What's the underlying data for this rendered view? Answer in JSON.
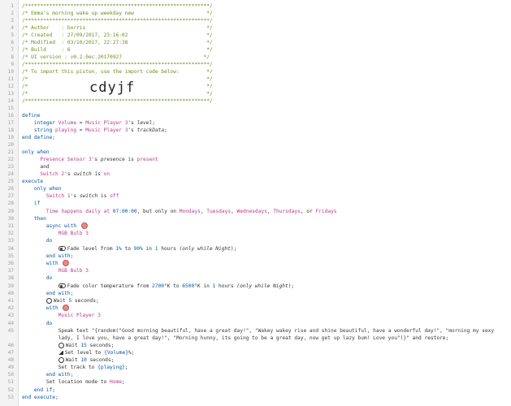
{
  "header": {
    "l1": "/*************************************************************/",
    "l2": "/* Emma's morning wake up weekday new                        */",
    "l3": "/*************************************************************/",
    "l4": "/* Author    : borris                                        */",
    "l5": "/* Created   : 27/09/2017, 23:16:02                          */",
    "l6": "/* Modified  : 03/10/2017, 22:27:38                          */",
    "l7": "/* Build     : 6                                             */",
    "l8": "/* UI version : v0.2.0ec.20170927                           */",
    "l9": "/*************************************************************/",
    "l10": "/* To import this piston, use the import code below:         */",
    "l11": "/*                                                           */",
    "l12": "/*                                                           */",
    "l13": "/*                                                           */",
    "l14": "/*************************************************************/",
    "import_code": "cdyjf"
  },
  "code": {
    "define": "define",
    "integer_kw": "integer",
    "volume_var": "Volume",
    "eq": " = ",
    "music_player_3": "Music Player 3",
    "s_level": "'s ",
    "level": "level",
    "semicolon": ";",
    "string_kw": "string",
    "playing_var": "playing",
    "track_data": "trackData",
    "end_define": "end define;",
    "only_when": "only when",
    "presence_sensor": "Presence Sensor 3",
    "presence_attr": "presence",
    "is": " is ",
    "present": "present",
    "and": "and",
    "switch2": "Switch 2",
    "switch_attr": "switch",
    "on": "on",
    "execute": "execute",
    "only_when_2": "only when",
    "switch1": "Switch 1",
    "off": "off",
    "if": "if",
    "time_happens": "Time happens daily at ",
    "time_value": "07:00:00",
    "but_only_on": ", but only on ",
    "mondays": "Mondays",
    "tuesdays": "Tuesdays",
    "wednesdays": "Wednesdays",
    "thursdays": "Thursdays",
    "or": ", or ",
    "fridays": "Fridays",
    "comma": ", ",
    "then": "then",
    "async_with": "async with",
    "rgb_bulb_3": "RGB Bulb 3",
    "do": "do",
    "fade_level_text": "Fade level from ",
    "pct1": "1%",
    "to": " to ",
    "pct90": "90%",
    "in": " in ",
    "one": "1",
    "hours": " hours ",
    "only_while": "(only while ",
    "night": "Night",
    "close_paren": ");",
    "end_with": "end with;",
    "with": "with",
    "fade_color_text": "Fade color temperature from ",
    "k2700": "2700",
    "k6500": "6500",
    "kdeg": "°K",
    "wait5": "Wait ",
    "five": "5",
    "seconds": " seconds;",
    "speak_text": "Speak text ",
    "speak_line1": "\"{random(\"Good morning beautiful, have a great day!\", \"Wakey wakey rise and shine beautiful, have a wonderful day!\", \"morning my sexy",
    "speak_line2": "lady, I love you, have a great day!\", \"Morning hunny, its going to be a great day, now get up lazy bum! Love you\")}\"",
    "and_restore": " and restore;",
    "wait15": "15",
    "set_level_to": "Set level to ",
    "volume_expr": "{Volume}",
    "pct_semicolon": "%;",
    "wait10": "10",
    "set_track_to": "Set track to ",
    "playing_expr": "{playing}",
    "set_location_mode": "Set location mode to ",
    "home": "Home",
    "end_if": "end if;",
    "end_execute": "end execute;"
  },
  "icons": {
    "dot": "async-marker-icon",
    "toggle": "toggle-icon",
    "clock": "clock-icon",
    "volume": "volume-icon",
    "music": "music-icon"
  },
  "colors": {
    "keyword": "#0b54a6",
    "device": "#b93a8e",
    "comment": "#6b8e23",
    "gutter": "#f3f3f3"
  }
}
